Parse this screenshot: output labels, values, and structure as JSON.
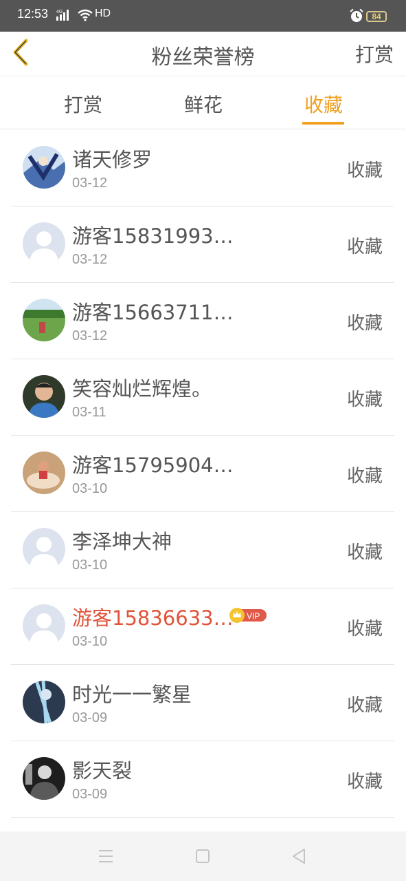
{
  "status_bar": {
    "time": "12:53",
    "network": "4G",
    "hd": "HD",
    "battery": "84"
  },
  "header": {
    "title": "粉丝荣誉榜",
    "action_label": "打赏"
  },
  "tabs": [
    {
      "label": "打赏",
      "active": false
    },
    {
      "label": "鲜花",
      "active": false
    },
    {
      "label": "收藏",
      "active": true
    }
  ],
  "colors": {
    "accent": "#f0a01e",
    "vip_name": "#e0543a",
    "text": "#555555",
    "status_bar": "#555555"
  },
  "rows": [
    {
      "name": "诸天修罗",
      "date": "03-12",
      "action": "收藏",
      "avatar": "anime-avatar"
    },
    {
      "name": "游客15831993…",
      "date": "03-12",
      "action": "收藏",
      "avatar": "default-avatar"
    },
    {
      "name": "游客15663711…",
      "date": "03-12",
      "action": "收藏",
      "avatar": "field-photo-avatar"
    },
    {
      "name": "笑容灿烂辉煌。",
      "date": "03-11",
      "action": "收藏",
      "avatar": "child-photo-avatar"
    },
    {
      "name": "游客15795904…",
      "date": "03-10",
      "action": "收藏",
      "avatar": "child-toy-photo-avatar"
    },
    {
      "name": "李泽坤大神",
      "date": "03-10",
      "action": "收藏",
      "avatar": "default-avatar"
    },
    {
      "name": "游客15836633…",
      "date": "03-10",
      "action": "收藏",
      "avatar": "default-avatar",
      "vip": "VIP"
    },
    {
      "name": "时光一一繁星",
      "date": "03-09",
      "action": "收藏",
      "avatar": "anime-avatar"
    },
    {
      "name": "影天裂",
      "date": "03-09",
      "action": "收藏",
      "avatar": "bw-photo-avatar"
    }
  ]
}
